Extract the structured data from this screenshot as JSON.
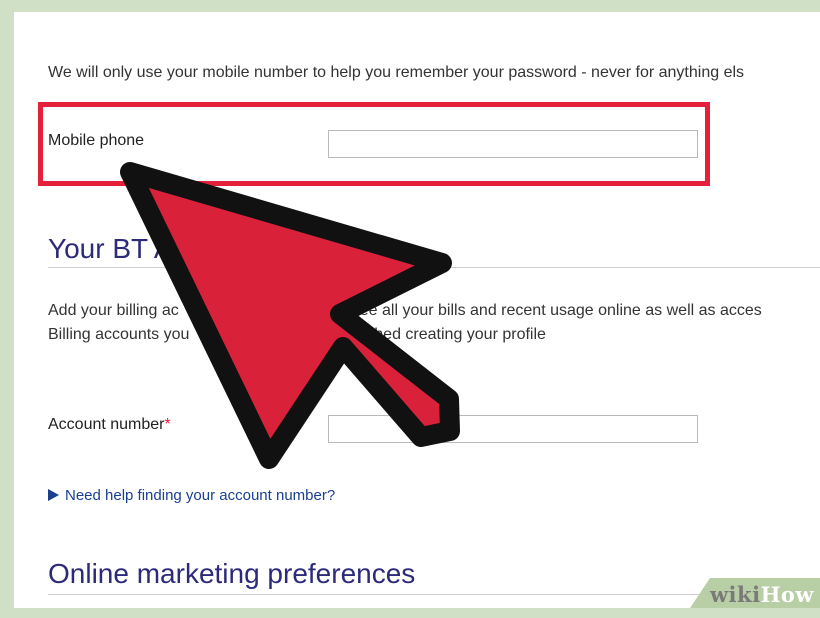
{
  "intro_text": "We will only use your mobile number to help you remember your password - never for anything els",
  "mobile": {
    "label": "Mobile phone",
    "value": ""
  },
  "bt_section": {
    "heading": "Your BT A",
    "line1_left": "Add your billing ac",
    "line1_right": "see all your bills and recent usage online as well as acces",
    "line2_left": "Billing accounts you",
    "line2_right": "'ve finished creating your profile"
  },
  "account": {
    "label": "Account number",
    "required_mark": "*",
    "value": ""
  },
  "help_link": "Need help finding your account number?",
  "marketing_heading": "Online marketing preferences",
  "watermark": {
    "part1": "wiki",
    "part2": "How"
  },
  "colors": {
    "heading": "#2d2a7a",
    "highlight_border": "#e5203a",
    "arrow_fill": "#d9223a",
    "link": "#1a3f8f"
  },
  "icons": [
    "pointer-arrow-icon",
    "triangle-right-icon"
  ]
}
